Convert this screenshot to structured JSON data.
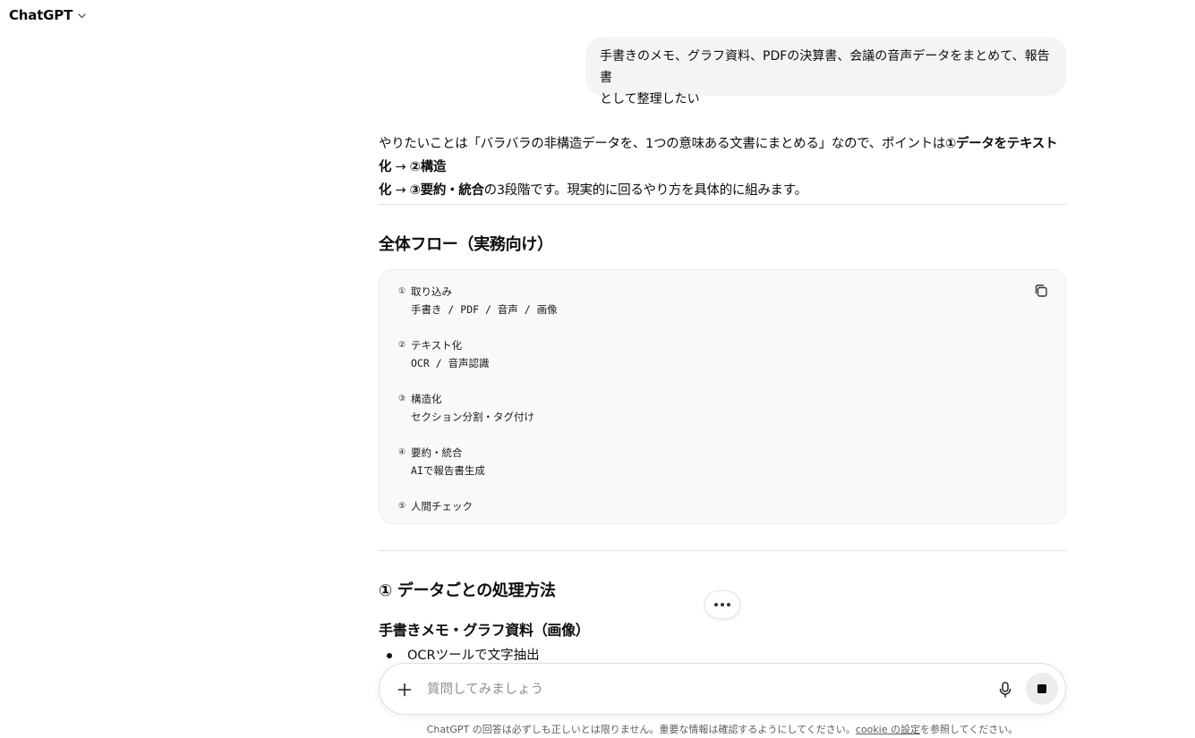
{
  "header": {
    "model_name": "ChatGPT",
    "dropdown_icon": "chevron-down-icon"
  },
  "user_message": {
    "line1": "手書きのメモ、グラフ資料、PDFの決算書、会議の音声データをまとめて、報告書",
    "line2": "として整理したい"
  },
  "answer": {
    "intro_a": "やりたいことは「バラバラの非構造データを、1つの意味ある文書にまとめる」なので、ポイントは",
    "intro_b1": "①データをテキスト化",
    "intro_arrow1": " → ",
    "intro_b2a": "②構造",
    "intro_b2b": "化",
    "intro_arrow2": " → ",
    "intro_b3": "③要約・統合",
    "intro_c": "の3段階です。現実的に回るやり方を具体的に組みます。",
    "section1_title": "全体フロー（実務向け）",
    "flow": [
      {
        "bullet": "①",
        "title": "取り込み",
        "sub": "手書き / PDF / 音声 / 画像"
      },
      {
        "bullet": "②",
        "title": "テキスト化",
        "sub": "OCR / 音声認識"
      },
      {
        "bullet": "③",
        "title": "構造化",
        "sub": "セクション分割・タグ付け"
      },
      {
        "bullet": "④",
        "title": "要約・統合",
        "sub": "AIで報告書生成"
      },
      {
        "bullet": "⑤",
        "title": "人間チェック",
        "sub": ""
      }
    ],
    "section2_title": "① データごとの処理方法",
    "subsection_title": "手書きメモ・グラフ資料（画像）",
    "list": [
      "OCRツールで文字抽出"
    ]
  },
  "composer": {
    "placeholder": "質問してみましょう"
  },
  "footer": {
    "disclaimer_a": "ChatGPT の回答は必ずしも正しいとは限りません。重要な情報は確認するようにしてください。",
    "cookie_link": "cookie の設定",
    "disclaimer_b": "を参照してください。"
  }
}
